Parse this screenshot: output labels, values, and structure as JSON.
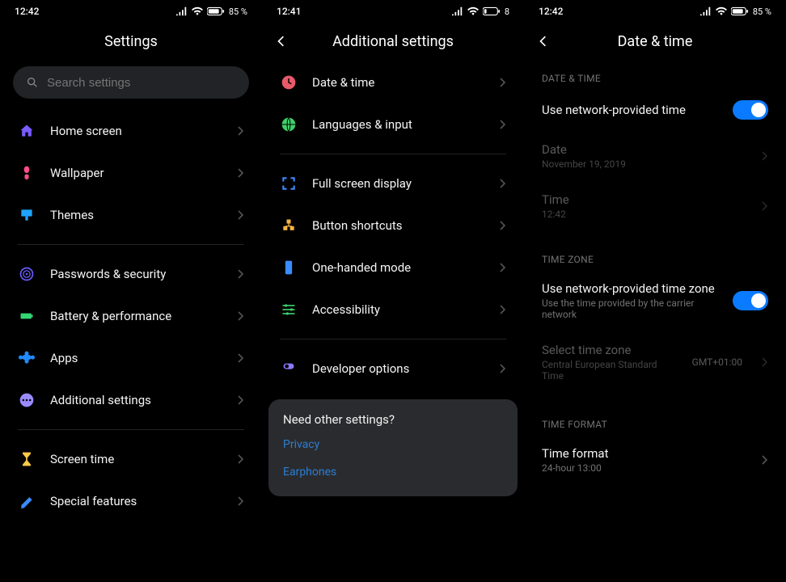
{
  "screens": {
    "settings": {
      "time": "12:42",
      "battery": "85 %",
      "title": "Settings",
      "search_placeholder": "Search settings",
      "groups": [
        {
          "items": [
            {
              "icon": "home",
              "color": "#7a5cff",
              "label": "Home screen"
            },
            {
              "icon": "wallpaper",
              "color": "#ff4d8a",
              "label": "Wallpaper"
            },
            {
              "icon": "themes",
              "color": "#1fa3ff",
              "label": "Themes"
            }
          ]
        },
        {
          "items": [
            {
              "icon": "security",
              "color": "#6a5cff",
              "label": "Passwords & security"
            },
            {
              "icon": "battery",
              "color": "#33d673",
              "label": "Battery & performance"
            },
            {
              "icon": "apps",
              "color": "#1f8bff",
              "label": "Apps"
            },
            {
              "icon": "additional",
              "color": "#9a8cff",
              "label": "Additional settings"
            }
          ]
        },
        {
          "items": [
            {
              "icon": "screentime",
              "color": "#ffc94a",
              "label": "Screen time"
            },
            {
              "icon": "special",
              "color": "#3a8bff",
              "label": "Special features"
            }
          ]
        }
      ]
    },
    "additional": {
      "time": "12:41",
      "battery": "8",
      "title": "Additional settings",
      "groups": [
        {
          "items": [
            {
              "icon": "clock",
              "color": "#e85a6a",
              "label": "Date & time"
            },
            {
              "icon": "globe",
              "color": "#3fcf6a",
              "label": "Languages & input"
            }
          ]
        },
        {
          "items": [
            {
              "icon": "fullscreen",
              "color": "#3a8bff",
              "label": "Full screen display"
            },
            {
              "icon": "buttons",
              "color": "#f5b342",
              "label": "Button shortcuts"
            },
            {
              "icon": "onehand",
              "color": "#3a8bff",
              "label": "One-handed mode"
            },
            {
              "icon": "accessibility",
              "color": "#3fcf6a",
              "label": "Accessibility"
            }
          ]
        },
        {
          "items": [
            {
              "icon": "developer",
              "color": "#8a7aff",
              "label": "Developer options"
            }
          ]
        }
      ],
      "other": {
        "title": "Need other settings?",
        "links": [
          "Privacy",
          "Earphones"
        ]
      }
    },
    "datetime": {
      "time": "12:42",
      "battery": "85 %",
      "title": "Date & time",
      "sections": {
        "dt_header": "DATE & TIME",
        "use_network_time": "Use network-provided time",
        "date_label": "Date",
        "date_value": "November 19, 2019",
        "time_label": "Time",
        "time_value": "12:42",
        "tz_header": "TIME ZONE",
        "use_network_tz": "Use network-provided time zone",
        "use_network_tz_sub": "Use the time provided by the carrier network",
        "select_tz": "Select time zone",
        "select_tz_value": "Central European Standard Time",
        "select_tz_trail": "GMT+01:00",
        "tf_header": "TIME FORMAT",
        "time_format": "Time format",
        "time_format_value": "24-hour 13:00"
      }
    }
  }
}
